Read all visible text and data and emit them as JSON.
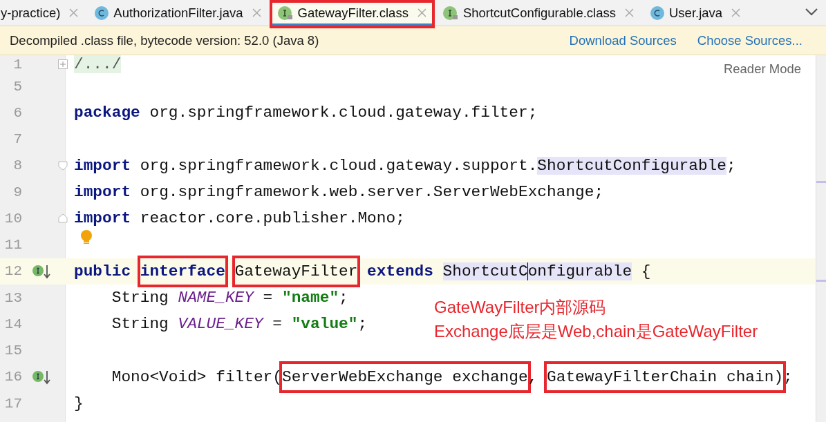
{
  "tabs": [
    {
      "label": "y-practice)",
      "kind": "plain",
      "selected": false,
      "boxed": false
    },
    {
      "label": "AuthorizationFilter.java",
      "kind": "class",
      "selected": false,
      "boxed": false
    },
    {
      "label": "GatewayFilter.class",
      "kind": "interface",
      "selected": true,
      "boxed": true
    },
    {
      "label": "ShortcutConfigurable.class",
      "kind": "interface",
      "selected": false,
      "boxed": false
    },
    {
      "label": "User.java",
      "kind": "class",
      "selected": false,
      "boxed": false
    }
  ],
  "banner": {
    "message": "Decompiled .class file, bytecode version: 52.0 (Java 8)",
    "links": [
      "Download Sources",
      "Choose Sources..."
    ]
  },
  "reader_mode": "Reader Mode",
  "lines": [
    {
      "number": "1",
      "current": false,
      "marks": [
        {
          "kind": "fold-collapsed"
        }
      ],
      "tokens": [
        {
          "text": "/.../",
          "kind": "folded"
        }
      ]
    },
    {
      "number": "5",
      "current": false
    },
    {
      "number": "6",
      "current": false,
      "tokens": [
        {
          "text": "package",
          "kind": "keyword"
        },
        {
          "text": " org.springframework.cloud.gateway.filter;",
          "kind": "plain"
        }
      ]
    },
    {
      "number": "7",
      "current": false
    },
    {
      "number": "8",
      "current": false,
      "marks": [
        {
          "kind": "fold-open"
        }
      ],
      "tokens": [
        {
          "text": "import",
          "kind": "keyword"
        },
        {
          "text": " org.springframework.cloud.gateway.support.",
          "kind": "plain"
        },
        {
          "text": "ShortcutConfigurable",
          "kind": "plain",
          "highlight": true
        },
        {
          "text": ";",
          "kind": "plain"
        }
      ]
    },
    {
      "number": "9",
      "current": false,
      "tokens": [
        {
          "text": "import",
          "kind": "keyword"
        },
        {
          "text": " org.springframework.web.server.ServerWebExchange;",
          "kind": "plain"
        }
      ]
    },
    {
      "number": "10",
      "current": false,
      "marks": [
        {
          "kind": "fold-close"
        }
      ],
      "tokens": [
        {
          "text": "import",
          "kind": "keyword"
        },
        {
          "text": " reactor.core.publisher.Mono;",
          "kind": "plain"
        }
      ]
    },
    {
      "number": "11",
      "current": false,
      "marks": [
        {
          "kind": "bulb"
        }
      ]
    },
    {
      "number": "12",
      "current": true,
      "marks": [
        {
          "kind": "implemented"
        }
      ],
      "tokens": [
        {
          "text": "public ",
          "kind": "keyword"
        },
        {
          "text": "interface",
          "kind": "keyword",
          "boxed": true
        },
        {
          "text": "GatewayFilter",
          "kind": "plain",
          "boxed": true
        },
        {
          "text": " extends ",
          "kind": "keyword"
        },
        {
          "text": "ShortcutC",
          "kind": "plain",
          "highlight": true,
          "caret": true
        },
        {
          "text": "onfigurable",
          "kind": "plain",
          "highlight": true
        },
        {
          "text": " {",
          "kind": "plain"
        }
      ]
    },
    {
      "number": "13",
      "current": false,
      "tokens": [
        {
          "text": "    String ",
          "kind": "plain"
        },
        {
          "text": "NAME_KEY",
          "kind": "constant"
        },
        {
          "text": " = ",
          "kind": "plain"
        },
        {
          "text": "\"name\"",
          "kind": "string"
        },
        {
          "text": ";",
          "kind": "plain"
        }
      ]
    },
    {
      "number": "14",
      "current": false,
      "tokens": [
        {
          "text": "    String ",
          "kind": "plain"
        },
        {
          "text": "VALUE_KEY",
          "kind": "constant"
        },
        {
          "text": " = ",
          "kind": "plain"
        },
        {
          "text": "\"value\"",
          "kind": "string"
        },
        {
          "text": ";",
          "kind": "plain"
        }
      ]
    },
    {
      "number": "15",
      "current": false
    },
    {
      "number": "16",
      "current": false,
      "marks": [
        {
          "kind": "implemented"
        }
      ],
      "tokens": [
        {
          "text": "    Mono<Void> filter(",
          "kind": "plain"
        },
        {
          "text": "ServerWebExchange exchange",
          "kind": "plain",
          "boxed": true
        },
        {
          "text": ", ",
          "kind": "plain"
        },
        {
          "text": "GatewayFilterChain chain)",
          "kind": "plain",
          "boxed": true
        },
        {
          "text": ";",
          "kind": "plain"
        }
      ]
    },
    {
      "number": "17",
      "current": false,
      "tokens": [
        {
          "text": "}",
          "kind": "plain"
        }
      ]
    }
  ],
  "annotation": [
    "GateWayFilter内部源码",
    "Exchange底层是Web,chain是GateWayFilter"
  ]
}
